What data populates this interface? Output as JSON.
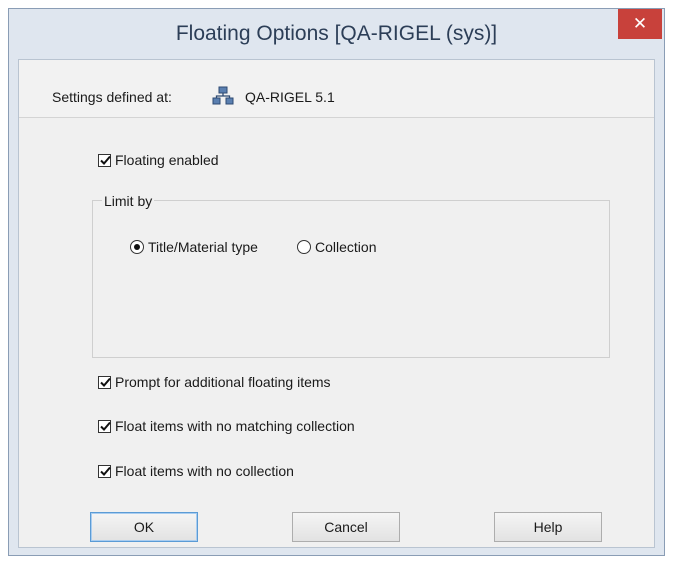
{
  "window": {
    "title": "Floating Options [QA-RIGEL (sys)]",
    "close_glyph": "✕"
  },
  "settings": {
    "label": "Settings defined at:",
    "icon": "network-server-icon",
    "value": "QA-RIGEL 5.1"
  },
  "floating_enabled": {
    "label": "Floating enabled",
    "checked": true
  },
  "limit_by": {
    "legend": "Limit by",
    "options": [
      {
        "label": "Title/Material type",
        "selected": true
      },
      {
        "label": "Collection",
        "selected": false
      }
    ]
  },
  "options": [
    {
      "label": "Prompt for additional floating items",
      "checked": true
    },
    {
      "label": "Float items with no matching collection",
      "checked": true
    },
    {
      "label": "Float items with no collection",
      "checked": true
    }
  ],
  "buttons": {
    "ok": "OK",
    "cancel": "Cancel",
    "help": "Help"
  },
  "colors": {
    "frame": "#dfe6ef",
    "close": "#c8413b",
    "client": "#f0f0f0",
    "default_button_border": "#5b9bd5"
  }
}
